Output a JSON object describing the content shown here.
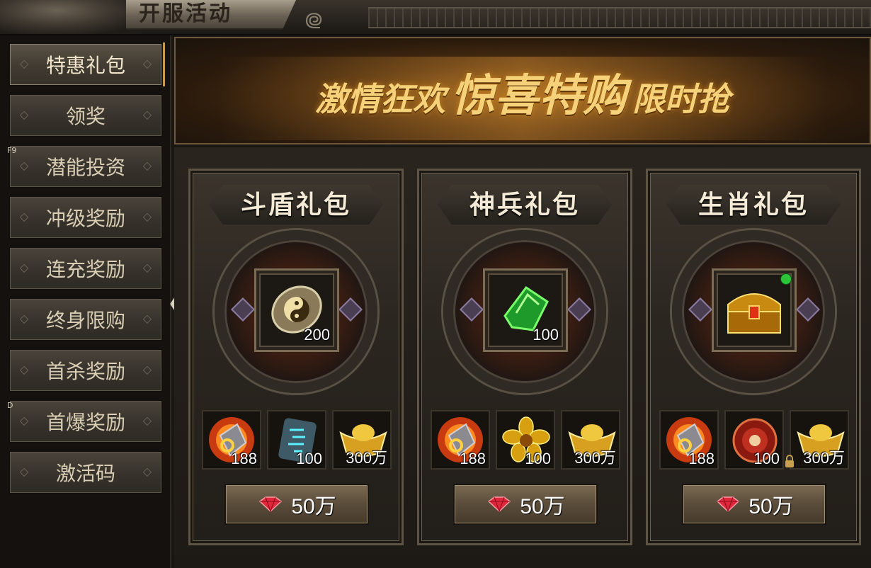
{
  "header": {
    "title": "开服活动"
  },
  "sidebar": {
    "items": [
      {
        "label": "特惠礼包",
        "active": true
      },
      {
        "label": "领奖"
      },
      {
        "label": "潜能投资"
      },
      {
        "label": "冲级奖励"
      },
      {
        "label": "连充奖励"
      },
      {
        "label": "终身限购"
      },
      {
        "label": "首杀奖励"
      },
      {
        "label": "首爆奖励"
      },
      {
        "label": "激活码"
      }
    ],
    "hotkeys": {
      "f9": "F9",
      "d": "D"
    }
  },
  "banner": {
    "part1": "激情狂欢",
    "part2": "惊喜特购",
    "part3": "限时抢"
  },
  "cards": [
    {
      "title": "斗盾礼包",
      "main_item": {
        "icon": "yin-yang-shield-icon",
        "qty": "200"
      },
      "items": [
        {
          "icon": "fire-ore-icon",
          "qty": "188"
        },
        {
          "icon": "rune-stone-icon",
          "qty": "100"
        },
        {
          "icon": "gold-ingot-icon",
          "qty": "300万"
        }
      ],
      "price": "50万"
    },
    {
      "title": "神兵礼包",
      "main_item": {
        "icon": "jade-shard-icon",
        "qty": "100"
      },
      "items": [
        {
          "icon": "fire-ore-icon",
          "qty": "188"
        },
        {
          "icon": "golden-flower-icon",
          "qty": "100"
        },
        {
          "icon": "gold-ingot-icon",
          "qty": "300万"
        }
      ],
      "price": "50万"
    },
    {
      "title": "生肖礼包",
      "main_item": {
        "icon": "treasure-chest-icon",
        "qty": ""
      },
      "items": [
        {
          "icon": "fire-ore-icon",
          "qty": "188"
        },
        {
          "icon": "red-emblem-icon",
          "qty": "100"
        },
        {
          "icon": "gold-ingot-icon",
          "qty": "300万",
          "locked": true
        }
      ],
      "price": "50万"
    }
  ],
  "colors": {
    "accent": "#c89a4a",
    "gem": "#e0283c",
    "banner_text": "#f5d27a"
  }
}
